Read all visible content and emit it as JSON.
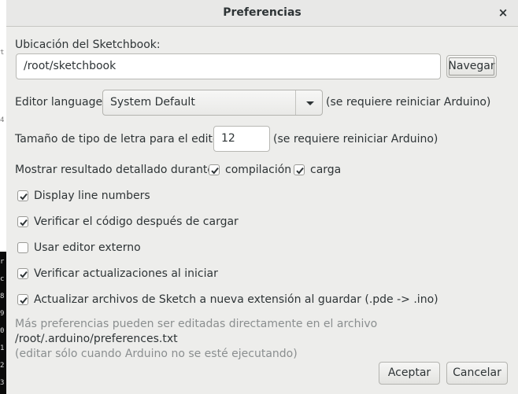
{
  "window": {
    "title": "Preferencias",
    "close_glyph": "×"
  },
  "sketchbook": {
    "label": "Ubicación del Sketchbook:",
    "path": "/root/sketchbook",
    "browse_button": "Navegar"
  },
  "editor_language": {
    "label": "Editor language:",
    "selected": "System Default",
    "note": "(se requiere reiniciar Arduino)"
  },
  "font_size": {
    "label": "Tamaño de tipo de letra para el editor:",
    "value": "12",
    "note": "(se requiere reiniciar Arduino)"
  },
  "verbose_output": {
    "label": "Mostrar resultado detallado durante:",
    "compile": {
      "label": "compilación",
      "checked": true
    },
    "upload": {
      "label": "carga",
      "checked": true
    }
  },
  "options": [
    {
      "label": "Display line numbers",
      "checked": true
    },
    {
      "label": "Verificar el código después de cargar",
      "checked": true
    },
    {
      "label": "Usar editor externo",
      "checked": false
    },
    {
      "label": "Verificar actualizaciones al iniciar",
      "checked": true
    },
    {
      "label": "Actualizar archivos de Sketch a nueva extensión al guardar (.pde -> .ino)",
      "checked": true
    }
  ],
  "footer": {
    "more_prefs": "Más preferencias pueden ser editadas directamente en el archivo",
    "prefs_path": "/root/.arduino/preferences.txt",
    "edit_note": "(editar sólo cuando Arduino no se esté ejecutando)"
  },
  "buttons": {
    "accept": "Aceptar",
    "cancel": "Cancelar"
  },
  "background_edge": {
    "chars": [
      "t",
      "r",
      "c",
      "8",
      "9",
      "0",
      "1",
      "2",
      "3",
      "4"
    ]
  }
}
